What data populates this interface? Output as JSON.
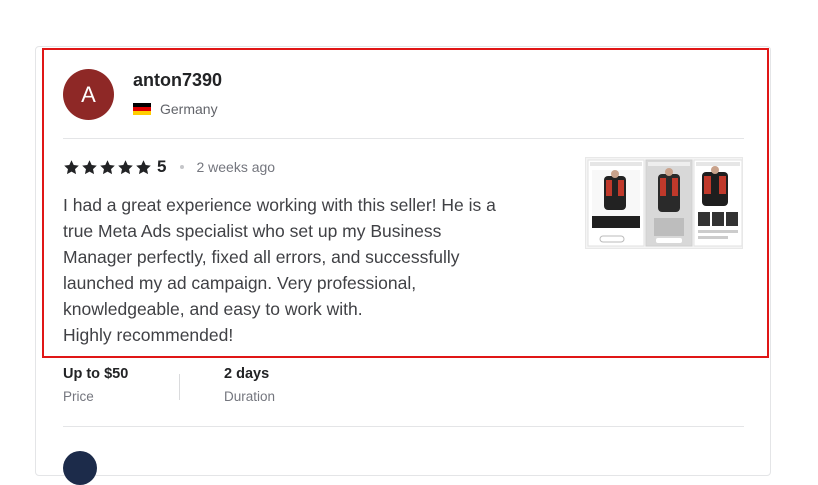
{
  "review": {
    "avatar_initial": "A",
    "avatar_color": "#8e2826",
    "username": "anton7390",
    "country": "Germany",
    "flag_colors": [
      "#000000",
      "#dd0000",
      "#ffce00"
    ],
    "rating": "5",
    "rating_fraction": 1.0,
    "star_color": "#222325",
    "time_ago": "2 weeks ago",
    "text": "I had a great experience working with this seller! He is a\ntrue Meta Ads specialist who set up my Business\nManager perfectly, fixed all errors, and successfully\nlaunched my ad campaign. Very professional,\nknowledgeable, and easy to work with.\nHighly recommended!",
    "thumbnail_icon": "ad-campaign-screenshot-thumbnail"
  },
  "order": {
    "price_value": "Up to $50",
    "price_label": "Price",
    "duration_value": "2 days",
    "duration_label": "Duration"
  },
  "highlight_color": "#e01616"
}
